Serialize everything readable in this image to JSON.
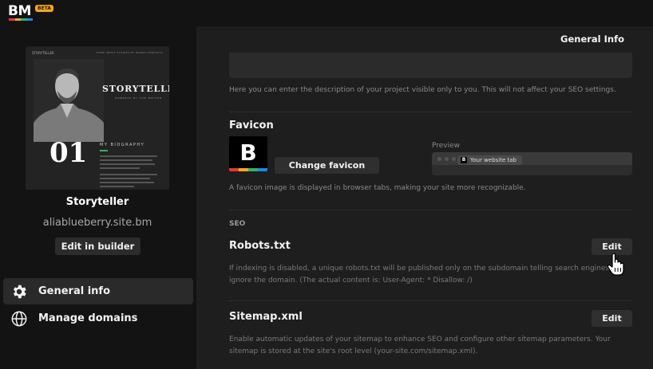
{
  "brand": {
    "logo_text": "BM",
    "badge": "BETA",
    "stripe_colors": [
      "#e53935",
      "#f5a623",
      "#2fb36b",
      "#1e88e5"
    ]
  },
  "site": {
    "thumbnail": {
      "brand": "STORYTELLER",
      "nav_links": "HOME  ABOUT  STORIES  MY WORKS  CONTACTS",
      "title": "STORYTELLER",
      "subtitle": "ROBERTS BY THE WRITER",
      "number": "01",
      "section_title": "MY BIOGRAPHY"
    },
    "name": "Storyteller",
    "url": "aliablueberry.site.bm",
    "edit_builder_label": "Edit in builder"
  },
  "nav": {
    "items": [
      {
        "label": "General info",
        "icon": "gear-icon",
        "active": true
      },
      {
        "label": "Manage domains",
        "icon": "globe-icon",
        "active": false
      }
    ]
  },
  "panel": {
    "title": "General Info",
    "description_help": "Here you can enter the description of your project visible only to you. This will not affect your SEO settings.",
    "favicon": {
      "heading": "Favicon",
      "letter": "B",
      "change_label": "Change favicon",
      "preview_label": "Preview",
      "preview_tab_label": "Your website tab",
      "help": "A favicon image is displayed in browser tabs, making your site more recognizable."
    },
    "seo_label": "SEO",
    "robots": {
      "heading": "Robots.txt",
      "edit_label": "Edit",
      "help_line1": "If indexing is disabled, a unique robots.txt will be published only on the subdomain telling search engines to",
      "help_line2": "ignore the domain. (The actual content is: User-Agent: * Disallow: /)"
    },
    "sitemap": {
      "heading": "Sitemap.xml",
      "edit_label": "Edit",
      "help_line1": "Enable automatic updates of your sitemap to enhance SEO and configure other sitemap parameters. Your",
      "help_line2": "sitemap is stored at the site's root level (your-site.com/sitemap.xml)."
    }
  }
}
